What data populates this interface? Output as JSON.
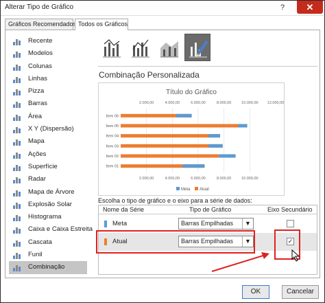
{
  "window": {
    "title": "Alterar Tipo de Gráfico",
    "close_symbol": "✕",
    "help_symbol": "?"
  },
  "tabs": [
    {
      "label": "Gráficos Recomendados"
    },
    {
      "label": "Todos os Gráficos"
    }
  ],
  "sidebar": {
    "items": [
      {
        "label": "Recente",
        "icon": "recent-icon"
      },
      {
        "label": "Modelos",
        "icon": "folder-icon"
      },
      {
        "label": "Colunas",
        "icon": "column-chart-icon"
      },
      {
        "label": "Linhas",
        "icon": "line-chart-icon"
      },
      {
        "label": "Pizza",
        "icon": "pie-chart-icon"
      },
      {
        "label": "Barras",
        "icon": "bar-chart-icon"
      },
      {
        "label": "Área",
        "icon": "area-chart-icon"
      },
      {
        "label": "X Y (Dispersão)",
        "icon": "scatter-chart-icon"
      },
      {
        "label": "Mapa",
        "icon": "map-icon"
      },
      {
        "label": "Ações",
        "icon": "stock-chart-icon"
      },
      {
        "label": "Superfície",
        "icon": "surface-chart-icon"
      },
      {
        "label": "Radar",
        "icon": "radar-chart-icon"
      },
      {
        "label": "Mapa de Árvore",
        "icon": "treemap-icon"
      },
      {
        "label": "Explosão Solar",
        "icon": "sunburst-icon"
      },
      {
        "label": "Histograma",
        "icon": "histogram-icon"
      },
      {
        "label": "Caixa e Caixa Estreita",
        "icon": "box-whisker-icon"
      },
      {
        "label": "Cascata",
        "icon": "waterfall-icon"
      },
      {
        "label": "Funil",
        "icon": "funnel-icon"
      },
      {
        "label": "Combinação",
        "icon": "combo-chart-icon",
        "selected": true
      }
    ]
  },
  "main": {
    "section_title": "Combinação Personalizada",
    "grid_caption": "Escolha o tipo de gráfico e o eixo para a série de dados:",
    "headers": {
      "name": "Nome da Série",
      "type": "Tipo de Gráfico",
      "axis": "Eixo Secundário"
    },
    "series_rows": [
      {
        "name": "Meta",
        "type": "Barras Empilhadas",
        "secondary_axis": false,
        "color": "#5b9bd5"
      },
      {
        "name": "Atual",
        "type": "Barras Empilhadas",
        "secondary_axis": true,
        "color": "#ed7d31"
      }
    ]
  },
  "chart_data": {
    "type": "bar",
    "title": "Título do Gráfico",
    "categories": [
      "Item 01",
      "Item 02",
      "Item 03",
      "Item 04",
      "Item 05",
      "Item 06"
    ],
    "series": [
      {
        "name": "Meta",
        "values": [
          1700,
          1300,
          1100,
          900,
          700,
          1200
        ],
        "color": "#5b9bd5"
      },
      {
        "name": "Atual",
        "values": [
          6500,
          7600,
          7900,
          7700,
          9800,
          5500
        ],
        "color": "#ed7d31"
      }
    ],
    "top_ticks": [
      "2.000,00",
      "4.000,00",
      "6.000,00",
      "8.000,00",
      "10.000,00",
      "12.000,00"
    ],
    "bottom_ticks": [
      "2.000,00",
      "4.000,00",
      "6.000,00",
      "8.000,00",
      "10.000,00"
    ],
    "xlim": [
      0,
      12000
    ],
    "legend": "bottom"
  },
  "footer": {
    "ok": "OK",
    "cancel": "Cancelar"
  }
}
